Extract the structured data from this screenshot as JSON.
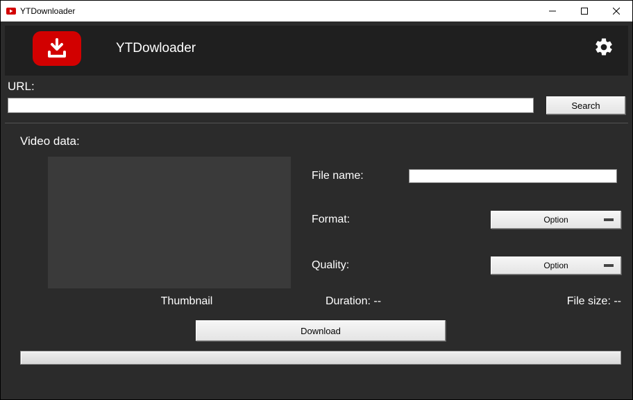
{
  "window": {
    "title": "YTDownloader"
  },
  "header": {
    "app_title": "YTDowloader"
  },
  "url": {
    "label": "URL:",
    "value": "",
    "search_label": "Search"
  },
  "video": {
    "section_label": "Video data:",
    "thumbnail_label": "Thumbnail",
    "filename_label": "File name:",
    "filename_value": "",
    "format_label": "Format:",
    "format_option": "Option",
    "quality_label": "Quality:",
    "quality_option": "Option",
    "duration_label": "Duration: --",
    "filesize_label": "File size: --",
    "download_label": "Download"
  }
}
